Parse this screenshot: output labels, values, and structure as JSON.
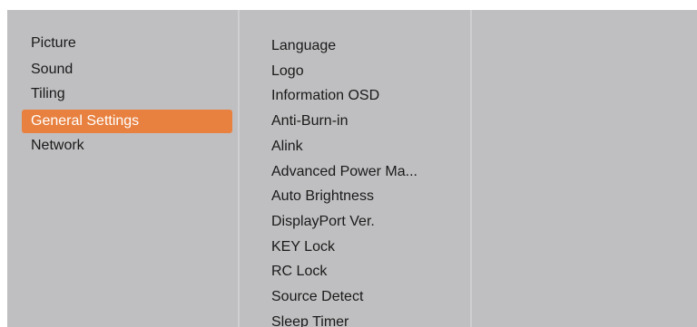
{
  "main_menu": {
    "items": [
      {
        "label": "Picture"
      },
      {
        "label": "Sound"
      },
      {
        "label": "Tiling"
      },
      {
        "label": "General Settings",
        "selected": true
      },
      {
        "label": "Network"
      }
    ]
  },
  "sub_menu": {
    "items": [
      {
        "label": "Language"
      },
      {
        "label": "Logo"
      },
      {
        "label": "Information OSD"
      },
      {
        "label": "Anti-Burn-in"
      },
      {
        "label": "Alink"
      },
      {
        "label": "Advanced Power Ma..."
      },
      {
        "label": "Auto Brightness"
      },
      {
        "label": "DisplayPort Ver."
      },
      {
        "label": "KEY Lock"
      },
      {
        "label": "RC Lock"
      },
      {
        "label": "Source Detect"
      },
      {
        "label": "Sleep Timer"
      }
    ]
  },
  "colors": {
    "panel_background": "#bfbfc1",
    "selection_accent": "#e8803f",
    "text": "#1a1a1a"
  }
}
